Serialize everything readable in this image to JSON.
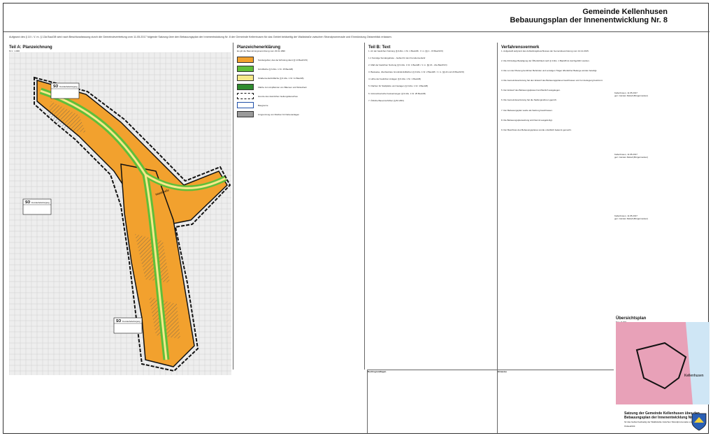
{
  "header": {
    "municipality": "Gemeinde Kellenhusen",
    "plan_title": "Bebauungsplan der Innenentwicklung Nr. 8"
  },
  "notes_text": "Aufgrund des § 10 i. V. m. § 13a BauGB wird nach Beschlussfassung durch die Gemeindevertretung vom 11.05.2017 folgende Satzung über den Bebauungsplan der Innenentwicklung Nr. 8 der Gemeinde Kellenhusen für das Gebiet beidseitig der Waldstraße zwischen Strandpromenade und Einmündung Ostseeblick erlassen.",
  "sections": {
    "part_a": "Teil A: Planzeichnung",
    "part_a_scale": "M 1 : 1.000",
    "legend": "Planzeichenerklärung",
    "legend_sub": "Es gilt die Baunutzungsverordnung vom 23.01.1990",
    "part_b": "Teil B: Text",
    "procedure": "Verfahrensvermerk",
    "overview": "Übersichtsplan",
    "overview_scale": "M 1 : 5.000",
    "overview_place": "Kellenhusen"
  },
  "legend_items": [
    {
      "label": "Sondergebiet, das der Erholung dient (§ 10 BauNVO)",
      "color": "#f2a12e"
    },
    {
      "label": "Grünfläche (§ 9 Abs. 1 Nr. 15 BauGB)",
      "color": "#5fbf3a"
    },
    {
      "label": "Straßenverkehrsfläche (§ 9 Abs. 1 Nr. 11 BauGB)",
      "color": "#f6e98a"
    },
    {
      "label": "Fläche zum Anpflanzen von Bäumen und Sträuchern",
      "color": "#2e8b2e"
    },
    {
      "label": "Grenze des räumlichen Geltungsbereiches",
      "color": "#111111"
    },
    {
      "label": "Baugrenze",
      "color": "#1f4fa8"
    },
    {
      "label": "Umgrenzung von Flächen für Nebenanlagen",
      "color": "#9a9a9a"
    }
  ],
  "part_b_items": [
    "1. Art der baulichen Nutzung (§ 9 Abs. 1 Nr. 1 BauGB i. V. m. §§ 1 - 15 BauNVO)",
    "1.1 Sonstige Sondergebiete - Gebiet für den Fremdenverkehr",
    "2. Maß der baulichen Nutzung (§ 9 Abs. 1 Nr. 1 BauGB i. V. m. §§ 16 - 21a BauNVO)",
    "3. Bauweise, überbaubare Grundstücksflächen (§ 9 Abs. 1 Nr. 2 BauGB i. V. m. §§ 22 und 23 BauNVO)",
    "4. Höhe der baulichen Anlagen (§ 9 Abs. 1 Nr. 1 BauGB)",
    "5. Flächen für Stellplätze und Garagen (§ 9 Abs. 1 Nr. 4 BauGB)",
    "6. Grünordnerische Festsetzungen (§ 9 Abs. 1 Nr. 25 BauGB)",
    "7. Örtliche Bauvorschriften (§ 84 LBO)"
  ],
  "procedure_items": [
    "1. Aufgestellt aufgrund des Aufstellungsbeschlusses der Gemeindevertretung vom 14.12.2015.",
    "2. Die frühzeitige Beteiligung der Öffentlichkeit nach § 3 Abs. 1 BauGB ist durchgeführt worden.",
    "3. Die von der Planung berührten Behörden und sonstigen Träger öffentlicher Belange wurden beteiligt.",
    "4. Die Gemeindevertretung hat den Entwurf des Bebauungsplanes beschlossen und zur Auslegung bestimmt.",
    "5. Der Entwurf des Bebauungsplanes hat öffentlich ausgelegen.",
    "6. Die Gemeindevertretung hat die Stellungnahmen geprüft.",
    "7. Der Bebauungsplan wurde als Satzung beschlossen.",
    "8. Die Bebauungsplansatzung wird hiermit ausgefertigt.",
    "9. Der Beschluss des Bebauungsplanes wurde ortsüblich bekannt gemacht."
  ],
  "signature_place": "Kellenhusen",
  "signature_dates": [
    "11.05.2017",
    "11.05.2017",
    "11.05.2017"
  ],
  "signature_role": "gez. Carsten Rebell (Bürgermeister)",
  "stamp": {
    "title": "Satzung der Gemeinde Kellenhusen über den Bebauungsplan der Innenentwicklung Nr. 8",
    "sub": "für das Gebiet beidseitig der Waldstraße zwischen Strandpromenade und Einmündung Ostseeblick"
  },
  "legal_head": "Rechtsgrundlagen",
  "hint_head": "Hinweise",
  "map_street": "Waldstraße",
  "map_zone_label": "SO",
  "map_zone_sub": "Fremdenbeherbergung",
  "colors": {
    "zone": "#f2a12e",
    "green": "#5fbf3a",
    "street": "#f6e98a",
    "boundary": "#111111",
    "overview_urban": "#e8a1b8"
  }
}
